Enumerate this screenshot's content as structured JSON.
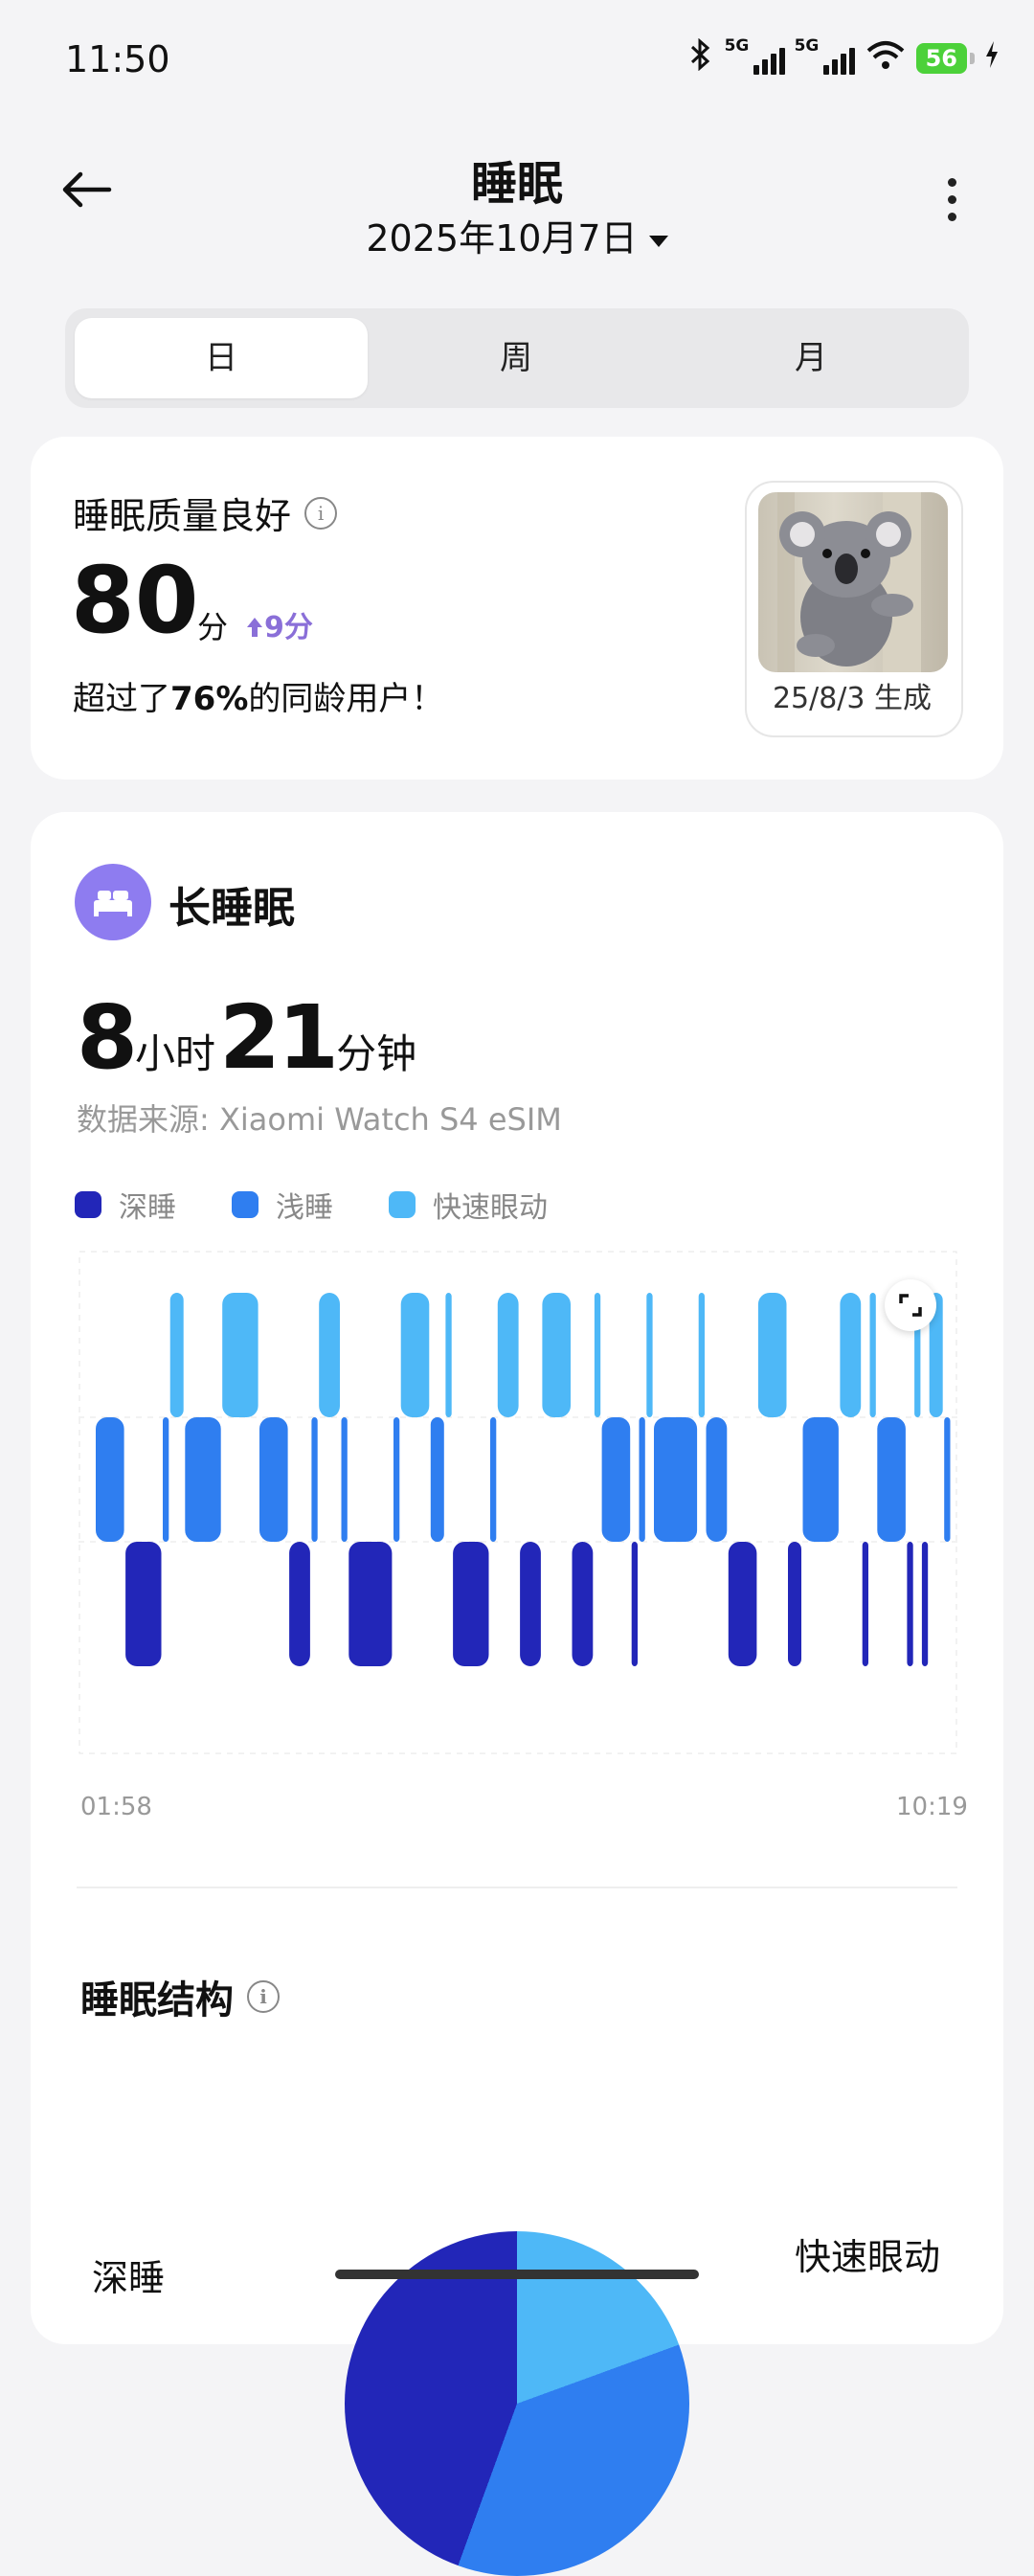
{
  "status": {
    "time": "11:50",
    "signal1": "5G",
    "signal2": "5G",
    "battery": "56"
  },
  "header": {
    "title": "睡眠",
    "date": "2025年10月7日"
  },
  "tabs": [
    "日",
    "周",
    "月"
  ],
  "quality": {
    "label": "睡眠质量良好",
    "score": "80",
    "unit": "分",
    "delta": "9分",
    "rank_prefix": "超过了",
    "rank_pct": "76%",
    "rank_suffix": "的同龄用户！",
    "image_caption": "25/8/3 生成"
  },
  "sleep": {
    "title": "长睡眠",
    "hours": "8",
    "hours_unit": "小时",
    "minutes": "21",
    "minutes_unit": "分钟",
    "source": "数据来源: Xiaomi Watch S4 eSIM",
    "legend": [
      {
        "name": "深睡",
        "color": "#2226b8"
      },
      {
        "name": "浅睡",
        "color": "#2f7ef0"
      },
      {
        "name": "快速眼动",
        "color": "#4eb8f7"
      }
    ],
    "start_time": "01:58",
    "end_time": "10:19",
    "stages": [
      {
        "stage": "light",
        "weight": 4
      },
      {
        "stage": "deep",
        "weight": 5
      },
      {
        "stage": "light",
        "weight": 1
      },
      {
        "stage": "rem",
        "weight": 2
      },
      {
        "stage": "light",
        "weight": 5
      },
      {
        "stage": "rem",
        "weight": 5
      },
      {
        "stage": "light",
        "weight": 4
      },
      {
        "stage": "deep",
        "weight": 3
      },
      {
        "stage": "light",
        "weight": 1
      },
      {
        "stage": "rem",
        "weight": 3
      },
      {
        "stage": "light",
        "weight": 1
      },
      {
        "stage": "deep",
        "weight": 6
      },
      {
        "stage": "light",
        "weight": 1
      },
      {
        "stage": "rem",
        "weight": 4
      },
      {
        "stage": "light",
        "weight": 2
      },
      {
        "stage": "rem",
        "weight": 1
      },
      {
        "stage": "deep",
        "weight": 5
      },
      {
        "stage": "light",
        "weight": 1
      },
      {
        "stage": "rem",
        "weight": 3
      },
      {
        "stage": "deep",
        "weight": 3
      },
      {
        "stage": "rem",
        "weight": 4
      },
      {
        "stage": "deep",
        "weight": 3
      },
      {
        "stage": "rem",
        "weight": 1
      },
      {
        "stage": "light",
        "weight": 4
      },
      {
        "stage": "deep",
        "weight": 1
      },
      {
        "stage": "light",
        "weight": 1
      },
      {
        "stage": "rem",
        "weight": 1
      },
      {
        "stage": "light",
        "weight": 6
      },
      {
        "stage": "rem",
        "weight": 1
      },
      {
        "stage": "light",
        "weight": 3
      },
      {
        "stage": "deep",
        "weight": 4
      },
      {
        "stage": "rem",
        "weight": 4
      },
      {
        "stage": "deep",
        "weight": 2
      },
      {
        "stage": "light",
        "weight": 5
      },
      {
        "stage": "rem",
        "weight": 3
      },
      {
        "stage": "deep",
        "weight": 1
      },
      {
        "stage": "rem",
        "weight": 1
      },
      {
        "stage": "light",
        "weight": 4
      },
      {
        "stage": "deep",
        "weight": 1
      },
      {
        "stage": "rem",
        "weight": 1
      },
      {
        "stage": "deep",
        "weight": 1
      },
      {
        "stage": "rem",
        "weight": 2
      },
      {
        "stage": "light",
        "weight": 1
      }
    ]
  },
  "structure": {
    "title": "睡眠结构",
    "deep_label": "深睡",
    "rem_label": "快速眼动"
  }
}
